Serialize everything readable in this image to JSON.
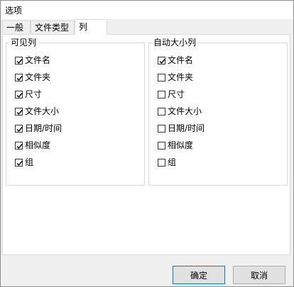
{
  "window": {
    "title": "选项"
  },
  "tabs": [
    {
      "label": "一般"
    },
    {
      "label": "文件类型"
    },
    {
      "label": "列",
      "active": true
    }
  ],
  "visible_columns": {
    "legend": "可见列",
    "items": [
      {
        "label": "文件名",
        "checked": true
      },
      {
        "label": "文件夹",
        "checked": true
      },
      {
        "label": "尺寸",
        "checked": true
      },
      {
        "label": "文件大小",
        "checked": true
      },
      {
        "label": "日期/时间",
        "checked": true
      },
      {
        "label": "相似度",
        "checked": true
      },
      {
        "label": "组",
        "checked": true
      }
    ]
  },
  "autosize_columns": {
    "legend": "自动大小列",
    "items": [
      {
        "label": "文件名",
        "checked": true
      },
      {
        "label": "文件夹",
        "checked": false
      },
      {
        "label": "尺寸",
        "checked": false
      },
      {
        "label": "文件大小",
        "checked": false
      },
      {
        "label": "日期/时间",
        "checked": false
      },
      {
        "label": "相似度",
        "checked": false
      },
      {
        "label": "组",
        "checked": false
      }
    ]
  },
  "buttons": {
    "ok": "确定",
    "cancel": "取消"
  }
}
